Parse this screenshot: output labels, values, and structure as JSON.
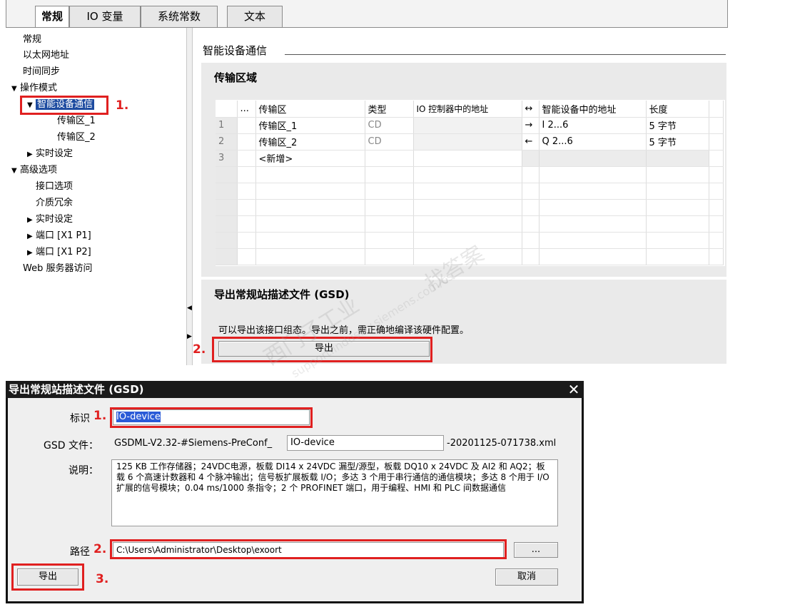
{
  "tabs": [
    "常规",
    "IO 变量",
    "系统常数",
    "文本"
  ],
  "nav": {
    "items": [
      {
        "label": "常规",
        "arrow": ""
      },
      {
        "label": "以太网地址",
        "arrow": ""
      },
      {
        "label": "时间同步",
        "arrow": ""
      },
      {
        "label": "操作模式",
        "arrow": "▼"
      },
      {
        "label": "智能设备通信",
        "arrow": "▼"
      },
      {
        "label": "传输区_1",
        "arrow": ""
      },
      {
        "label": "传输区_2",
        "arrow": ""
      },
      {
        "label": "实时设定",
        "arrow": "▶"
      },
      {
        "label": "高级选项",
        "arrow": "▼"
      },
      {
        "label": "接口选项",
        "arrow": ""
      },
      {
        "label": "介质冗余",
        "arrow": ""
      },
      {
        "label": "实时设定",
        "arrow": "▶"
      },
      {
        "label": "端口 [X1 P1]",
        "arrow": "▶"
      },
      {
        "label": "端口 [X1 P2]",
        "arrow": "▶"
      },
      {
        "label": "Web 服务器访问",
        "arrow": ""
      }
    ],
    "step1": "1."
  },
  "content": {
    "section_title": "智能设备通信",
    "transfer_title": "传输区域",
    "table": {
      "headers": [
        "",
        "...",
        "传输区",
        "类型",
        "IO 控制器中的地址",
        "↔",
        "智能设备中的地址",
        "长度"
      ],
      "rows": [
        [
          "1",
          "",
          "传输区_1",
          "CD",
          "",
          "→",
          "I 2...6",
          "5 字节"
        ],
        [
          "2",
          "",
          "传输区_2",
          "CD",
          "",
          "←",
          "Q 2...6",
          "5 字节"
        ],
        [
          "3",
          "",
          "<新增>",
          "",
          "",
          "",
          "",
          ""
        ]
      ]
    },
    "gsd_title": "导出常规站描述文件 (GSD)",
    "gsd_desc": "可以导出该接口组态。导出之前，需正确地编译该硬件配置。",
    "export_button": "导出",
    "step2": "2."
  },
  "watermark": {
    "line1": "西门子工业",
    "line2": "找答案",
    "line3": "support.industry.siemens.com/cs"
  },
  "dialog": {
    "title": "导出常规站描述文件 (GSD)",
    "id_label": "标识",
    "id_value": "IO-device",
    "gsd_label": "GSD 文件：",
    "gsd_prefix": "GSDML-V2.32-#Siemens-PreConf_",
    "gsd_middle": "IO-device",
    "gsd_suffix": "-20201125-071738.xml",
    "desc_label": "说明：",
    "desc_text": "125 KB 工作存储器；24VDC电源，板载 DI14 x 24VDC 漏型/源型，板载 DQ10 x 24VDC 及 AI2 和 AQ2；板载 6 个高速计数器和 4 个脉冲输出；信号板扩展板载 I/O；多达 3 个用于串行通信的通信模块；多达 8 个用于 I/O 扩展的信号模块；0.04 ms/1000 条指令；2 个 PROFINET 端口，用于编程、HMI 和 PLC 间数据通信",
    "path_label": "路径",
    "path_value": "C:\\Users\\Administrator\\Desktop\\exoort",
    "browse_label": "...",
    "export_label": "导出",
    "cancel_label": "取消",
    "step1": "1.",
    "step2": "2.",
    "step3": "3."
  }
}
